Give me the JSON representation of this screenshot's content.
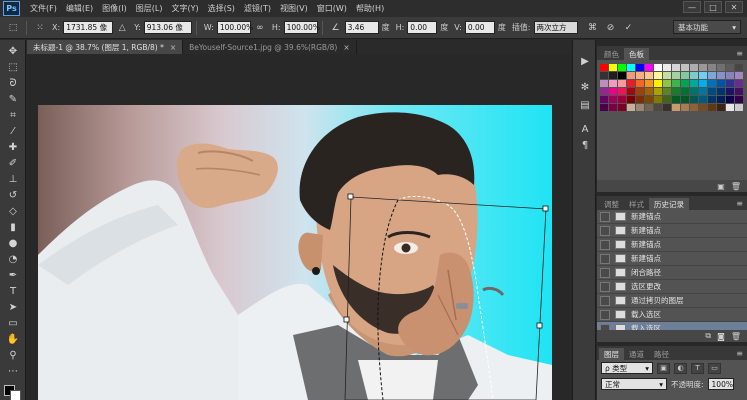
{
  "app": {
    "logo": "Ps"
  },
  "menu": [
    "文件(F)",
    "编辑(E)",
    "图像(I)",
    "图层(L)",
    "文字(Y)",
    "选择(S)",
    "滤镜(T)",
    "视图(V)",
    "窗口(W)",
    "帮助(H)"
  ],
  "window_controls": {
    "minimize": "—",
    "maximize": "□",
    "close": "✕"
  },
  "options": {
    "x_label": "X:",
    "x_value": "1731.85 像",
    "y_label": "Y:",
    "y_value": "913.06 像",
    "w_label": "W:",
    "w_value": "100.00%",
    "h_label": "H:",
    "h_value": "100.00%",
    "angle_value": "3.46",
    "angle_unit": "度",
    "hskew_label": "H:",
    "hskew_value": "0.00",
    "hskew_unit": "度",
    "vskew_label": "V:",
    "vskew_value": "0.00",
    "vskew_unit": "度",
    "interp_label": "插值:",
    "interp_value": "两次立方",
    "workspace": "基本功能"
  },
  "tabs": [
    {
      "label": "未标题-1 @ 38.7% (图层 1, RGB/8) *",
      "close": "×"
    },
    {
      "label": "BeYouself-Source1.jpg @ 39.6%(RGB/8)",
      "close": "×"
    }
  ],
  "swatches_panel": {
    "tabs": [
      "颜色",
      "色板"
    ]
  },
  "history_panel": {
    "tabs": [
      "调整",
      "样式",
      "历史记录"
    ],
    "items": [
      "新建锚点",
      "新建锚点",
      "新建锚点",
      "新建锚点",
      "闭合路径",
      "选区更改",
      "通过拷贝的图层",
      "载入选区",
      "载入选区"
    ]
  },
  "layers_panel": {
    "tabs": [
      "图层",
      "通道",
      "路径"
    ],
    "kind_label": "ρ 类型",
    "blend_mode": "正常",
    "opacity_label": "不透明度:",
    "opacity_value": "100%"
  },
  "swatch_colors": [
    "#ff0000",
    "#ffff00",
    "#00ff00",
    "#00ffff",
    "#0000ff",
    "#ff00ff",
    "#ffffff",
    "#ebebeb",
    "#d6d6d6",
    "#c2c2c2",
    "#adadad",
    "#999999",
    "#858585",
    "#707070",
    "#5c5c5c",
    "#474747",
    "#333333",
    "#1f1f1f",
    "#000000",
    "#f7977a",
    "#f9ad81",
    "#fdc68a",
    "#fff79a",
    "#c4df9b",
    "#a2d39c",
    "#82ca9d",
    "#7bcdc8",
    "#6ecff6",
    "#7ea7d8",
    "#8493ca",
    "#8882be",
    "#a187be",
    "#bc8dbf",
    "#f49ac2",
    "#f6989d",
    "#ed1c24",
    "#f26522",
    "#f7941d",
    "#fff200",
    "#8dc63f",
    "#39b54a",
    "#00a651",
    "#00a99d",
    "#00aeef",
    "#0072bc",
    "#0054a6",
    "#2e3192",
    "#662d91",
    "#92278f",
    "#ec008c",
    "#ed145b",
    "#9e0b0f",
    "#a0410d",
    "#a36209",
    "#aba000",
    "#598527",
    "#197b30",
    "#007236",
    "#00746b",
    "#0076a3",
    "#004a80",
    "#003471",
    "#1b1464",
    "#440e62",
    "#630460",
    "#9e005d",
    "#9e0039",
    "#790000",
    "#7b2e00",
    "#7d4900",
    "#827b00",
    "#406618",
    "#005e20",
    "#005826",
    "#005952",
    "#005b7f",
    "#003663",
    "#002157",
    "#0d004c",
    "#32004b",
    "#4b0049",
    "#7b0046",
    "#7a0026",
    "#c7b299",
    "#998675",
    "#736357",
    "#534741",
    "#37302d",
    "#c69c6d",
    "#a67c52",
    "#8c6239",
    "#754c24",
    "#603913",
    "#3c2415",
    "#e6e6e6",
    "#cccccc"
  ]
}
